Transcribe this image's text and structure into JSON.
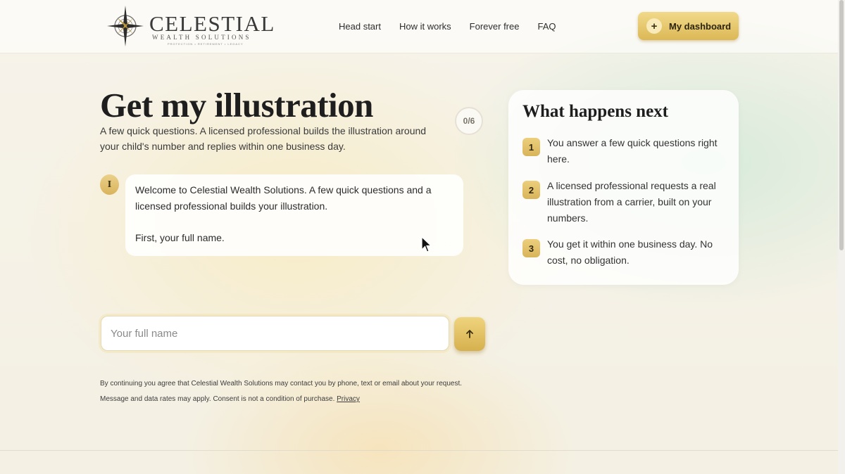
{
  "header": {
    "logo": {
      "name": "CELESTIAL",
      "sub": "WEALTH SOLUTIONS",
      "tagline": "PROTECTION • RETIREMENT • LEGACY"
    },
    "nav": [
      {
        "label": "Head start"
      },
      {
        "label": "How it works"
      },
      {
        "label": "Forever free"
      },
      {
        "label": "FAQ"
      }
    ],
    "dashboard_button": {
      "icon": "plus-icon",
      "label": "My dashboard"
    }
  },
  "main": {
    "title": "Get my illustration",
    "intro": "A few quick questions. A licensed professional builds the illustration around your child's number and replies within one business day.",
    "progress": "0/6",
    "chat": {
      "avatar_letter": "I",
      "message": "Welcome to Celestial Wealth Solutions. A few quick questions and a licensed professional builds your illustration.",
      "prompt": "First, your full name."
    },
    "input": {
      "placeholder": "Your full name",
      "value": ""
    },
    "send_button": {
      "icon": "arrow-up-icon"
    },
    "disclaimer": "By continuing you agree that Celestial Wealth Solutions may contact you by phone, text or email about your request. Message and data rates may apply. Consent is not a condition of purchase.",
    "privacy_link": "Privacy"
  },
  "next": {
    "title": "What happens next",
    "steps": [
      {
        "num": "1",
        "text": "You answer a few quick questions right here."
      },
      {
        "num": "2",
        "text": "A licensed professional requests a real illustration from a carrier, built on your numbers."
      },
      {
        "num": "3",
        "text": "You get it within one business day. No cost, no obligation."
      }
    ]
  },
  "colors": {
    "accent_gold": "#dcb856",
    "accent_light": "#f1d98a",
    "text_dark": "#1e1e1e"
  }
}
